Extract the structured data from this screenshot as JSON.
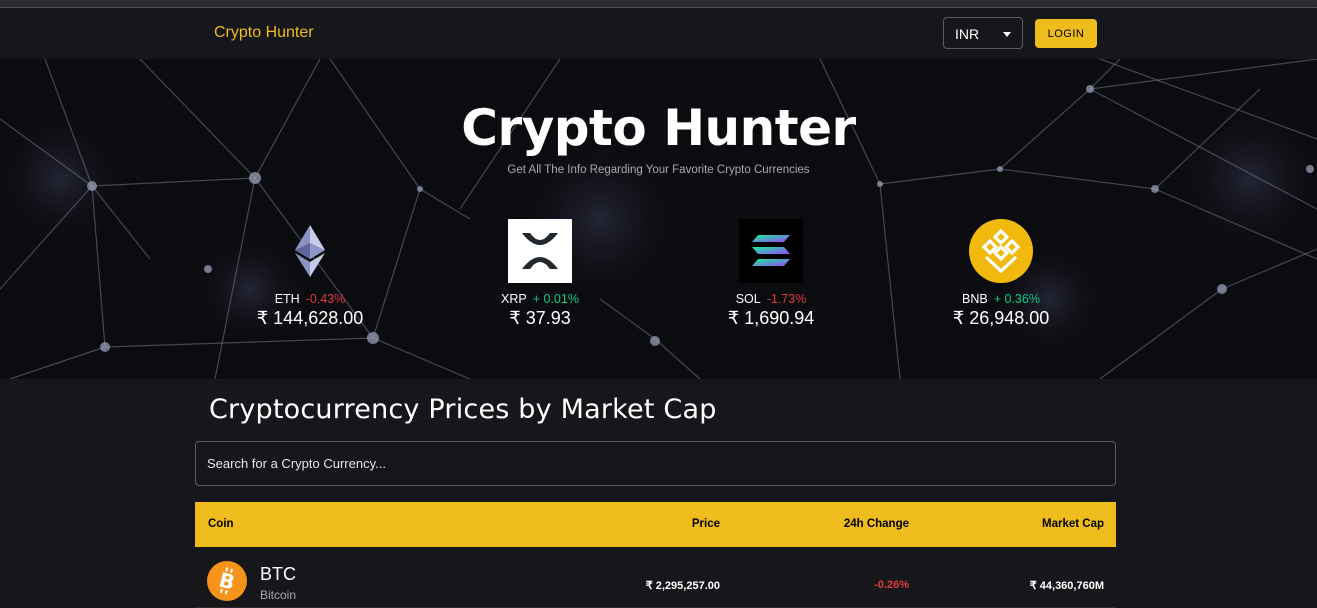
{
  "header": {
    "brand": "Crypto Hunter",
    "currency": "INR",
    "login_label": "LOGIN"
  },
  "banner": {
    "title": "Crypto Hunter",
    "subtitle": "Get All The Info Regarding Your Favorite Crypto Currencies",
    "coins": [
      {
        "symbol": "ETH",
        "change": "-0.43%",
        "price": "₹ 144,628.00",
        "icon": "ethereum-icon"
      },
      {
        "symbol": "XRP",
        "change": "+ 0.01%",
        "price": "₹ 37.93",
        "icon": "xrp-icon"
      },
      {
        "symbol": "SOL",
        "change": "-1.73%",
        "price": "₹ 1,690.94",
        "icon": "solana-icon"
      },
      {
        "symbol": "BNB",
        "change": "+ 0.36%",
        "price": "₹ 26,948.00",
        "icon": "bnb-icon"
      }
    ]
  },
  "main": {
    "title": "Cryptocurrency Prices by Market Cap",
    "search_placeholder": "Search for a Crypto Currency...",
    "columns": [
      "Coin",
      "Price",
      "24h Change",
      "Market Cap"
    ],
    "rows": [
      {
        "symbol": "BTC",
        "name": "Bitcoin",
        "price": "₹ 2,295,257.00",
        "change": "-0.26%",
        "market_cap": "₹ 44,360,760M",
        "icon": "bitcoin-icon"
      }
    ]
  },
  "colors": {
    "accent": "#eebc1d",
    "negative": "#e23b3b",
    "positive": "#0ecb81",
    "background": "#16171a"
  }
}
